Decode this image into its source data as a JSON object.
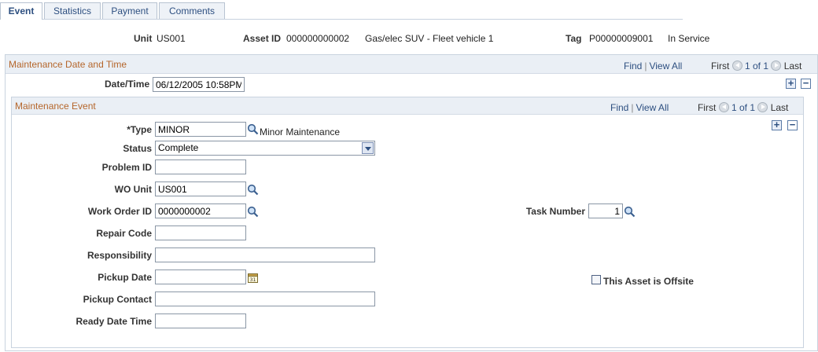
{
  "tabs": [
    {
      "label": "Event"
    },
    {
      "label": "Statistics"
    },
    {
      "label": "Payment"
    },
    {
      "label": "Comments"
    }
  ],
  "header": {
    "unit_label": "Unit",
    "unit_value": "US001",
    "asset_id_label": "Asset ID",
    "asset_id_value": "000000000002",
    "asset_desc": "Gas/elec SUV - Fleet vehicle 1",
    "tag_label": "Tag",
    "tag_value": "P00000009001",
    "status": "In Service"
  },
  "maint_date_section": {
    "title": "Maintenance Date and Time",
    "find": "Find",
    "view_all": "View All",
    "first": "First",
    "range": "1 of 1",
    "last": "Last",
    "datetime_label": "Date/Time",
    "datetime_value": "06/12/2005 10:58PM"
  },
  "maint_event_section": {
    "title": "Maintenance Event",
    "find": "Find",
    "view_all": "View All",
    "first": "First",
    "range": "1 of 1",
    "last": "Last"
  },
  "fields": {
    "type_label": "*Type",
    "type_value": "MINOR",
    "type_desc": "Minor Maintenance",
    "status_label": "Status",
    "status_value": "Complete",
    "problem_id_label": "Problem ID",
    "problem_id_value": "",
    "wo_unit_label": "WO Unit",
    "wo_unit_value": "US001",
    "work_order_label": "Work Order ID",
    "work_order_value": "0000000002",
    "task_number_label": "Task Number",
    "task_number_value": "1",
    "repair_code_label": "Repair Code",
    "repair_code_value": "",
    "responsibility_label": "Responsibility",
    "responsibility_value": "",
    "pickup_date_label": "Pickup Date",
    "pickup_date_value": "",
    "offsite_label": "This Asset is Offsite",
    "pickup_contact_label": "Pickup Contact",
    "pickup_contact_value": "",
    "ready_date_label": "Ready Date Time",
    "ready_date_value": ""
  },
  "icons": {
    "lookup": "magnifier-icon",
    "calendar": "calendar-icon",
    "first": "previous-arrow-icon",
    "last": "next-arrow-icon",
    "add": "plus-icon",
    "delete": "minus-icon"
  },
  "colors": {
    "section_title": "#b5662b",
    "link": "#2d4f80",
    "section_bg": "#eaeff5"
  }
}
